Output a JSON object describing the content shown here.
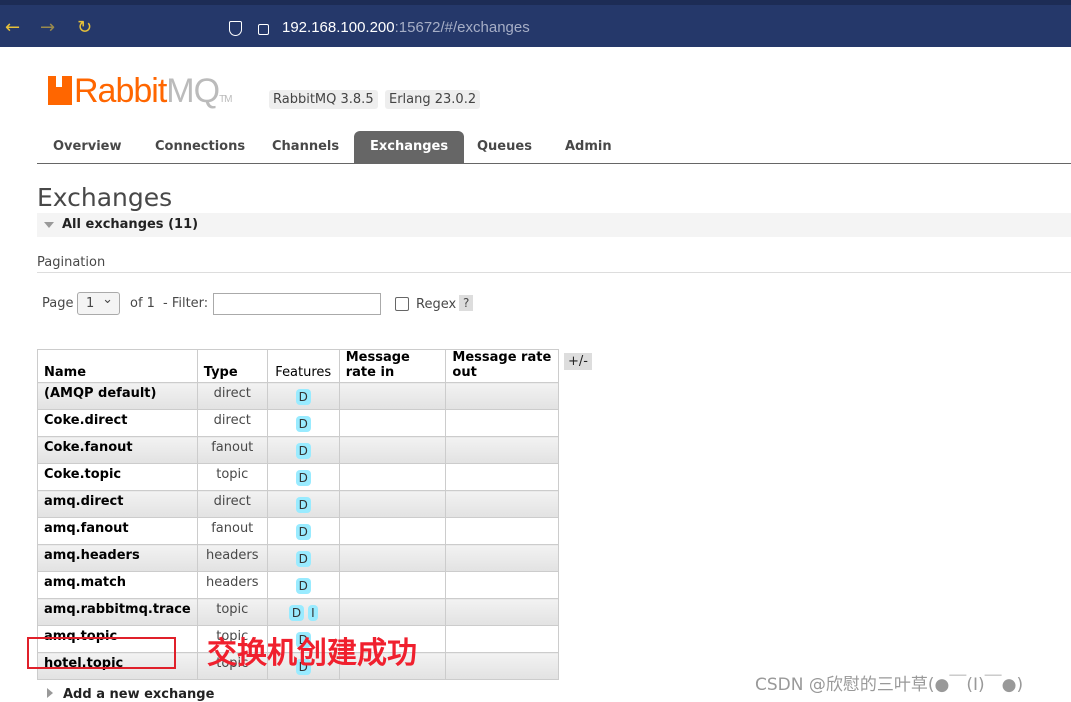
{
  "browser": {
    "url_host": "192.168.100.200",
    "url_rest": ":15672/#/exchanges"
  },
  "header": {
    "logo": "RabbitMQ",
    "rabbitmq_version": "RabbitMQ 3.8.5",
    "erlang_version": "Erlang 23.0.2"
  },
  "tabs": [
    {
      "label": "Overview"
    },
    {
      "label": "Connections"
    },
    {
      "label": "Channels"
    },
    {
      "label": "Exchanges",
      "active": true
    },
    {
      "label": "Queues"
    },
    {
      "label": "Admin"
    }
  ],
  "page": {
    "title": "Exchanges",
    "section": "All exchanges (11)",
    "pagination_label": "Pagination",
    "page_label": "Page",
    "page_value": "1",
    "of_label": "of 1",
    "filter_label": "- Filter:",
    "filter_value": "",
    "regex_label": "Regex",
    "help": "?",
    "toggle_columns": "+/-"
  },
  "table": {
    "headers": [
      "Name",
      "Type",
      "Features",
      "Message rate in",
      "Message rate out"
    ],
    "rows": [
      {
        "name": "(AMQP default)",
        "type": "direct",
        "features": [
          "D"
        ]
      },
      {
        "name": "Coke.direct",
        "type": "direct",
        "features": [
          "D"
        ]
      },
      {
        "name": "Coke.fanout",
        "type": "fanout",
        "features": [
          "D"
        ]
      },
      {
        "name": "Coke.topic",
        "type": "topic",
        "features": [
          "D"
        ]
      },
      {
        "name": "amq.direct",
        "type": "direct",
        "features": [
          "D"
        ]
      },
      {
        "name": "amq.fanout",
        "type": "fanout",
        "features": [
          "D"
        ]
      },
      {
        "name": "amq.headers",
        "type": "headers",
        "features": [
          "D"
        ]
      },
      {
        "name": "amq.match",
        "type": "headers",
        "features": [
          "D"
        ]
      },
      {
        "name": "amq.rabbitmq.trace",
        "type": "topic",
        "features": [
          "D",
          "I"
        ]
      },
      {
        "name": "amq.topic",
        "type": "topic",
        "features": [
          "D"
        ]
      },
      {
        "name": "hotel.topic",
        "type": "topic",
        "features": [
          "D"
        ]
      }
    ]
  },
  "annotation": "交换机创建成功",
  "add_exchange": "Add a new exchange",
  "watermark": "CSDN @欣慰的三叶草(●￣(I)￣●)",
  "colors": {
    "brand": "#ff6600",
    "feature_badge": "#99ebff",
    "annotation": "#f0202e"
  }
}
